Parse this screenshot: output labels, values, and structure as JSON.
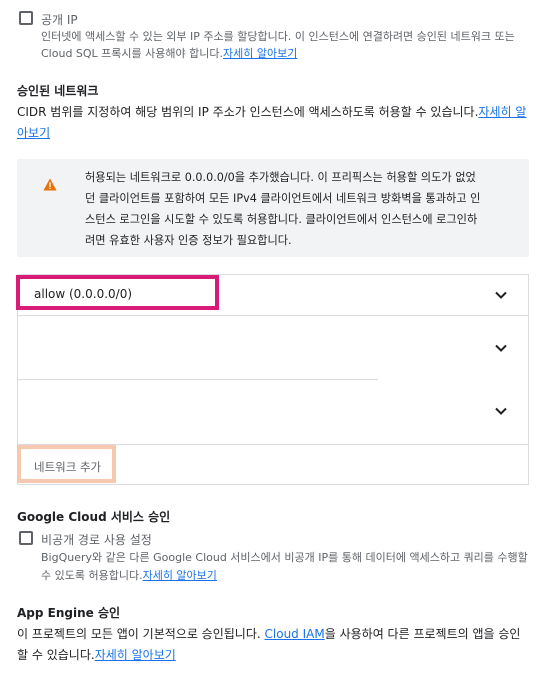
{
  "public_ip": {
    "label": "공개 IP",
    "desc_line1": "인터넷에 액세스할 수 있는 외부 IP 주소를 할당합니다. 이 인스턴스에 연결하려면 승인된 네트워크 또는",
    "desc_line2": "Cloud SQL 프록시를 사용해야 합니다.",
    "link": "자세히 알아보기"
  },
  "authorized_networks": {
    "title": "승인된 네트워크",
    "desc_line1": "CIDR 범위를 지정하여 해당 범위의 IP 주소가 인스턴스에 액세스하도록 허용할 수 있습니다.",
    "link_part1": "자세히 알",
    "link_part2": "아보기"
  },
  "warning": {
    "icon": "warning-icon",
    "line1": "허용되는 네트워크로 0.0.0.0/0을 추가했습니다. 이 프리픽스는 허용할 의도가 없었",
    "line2": "던 클라이언트를 포함하여 모든 IPv4 클라이언트에서 네트워크 방화벽을 통과하고 인",
    "line3": "스턴스 로그인을 시도할 수 있도록 허용합니다. 클라이언트에서 인스턴스에 로그인하",
    "line4": "려면 유효한 사용자 인증 정보가 필요합니다.",
    "color": "#e8710a"
  },
  "networks": [
    {
      "label": "allow (0.0.0.0/0)"
    },
    {
      "label": ""
    },
    {
      "label": ""
    }
  ],
  "add_network": {
    "label": "네트워크 추가"
  },
  "google_cloud": {
    "title": "Google Cloud 서비스 승인",
    "checkbox_label": "비공개 경로 사용 설정",
    "desc_line1": "BigQuery와 같은 다른 Google Cloud 서비스에서 비공개 IP를 통해 데이터에 액세스하고 쿼리를 수행할",
    "desc_line2": "수 있도록 허용합니다.",
    "link": "자세히 알아보기"
  },
  "app_engine": {
    "title": "App Engine 승인",
    "desc_line1_a": "이 프로젝트의 모든 앱이 기본적으로 승인됩니다. ",
    "desc_line1_link": "Cloud IAM",
    "desc_line1_b": "을 사용하여 다른 프로젝트의 앱을 승인",
    "desc_line2": "할 수 있습니다.",
    "link": "자세히 알아보기"
  },
  "colors": {
    "link": "#1a73e8",
    "highlight_allow": "#d81b76",
    "highlight_add": "#f6c8b0",
    "warning_bg": "#f1f3f4"
  }
}
